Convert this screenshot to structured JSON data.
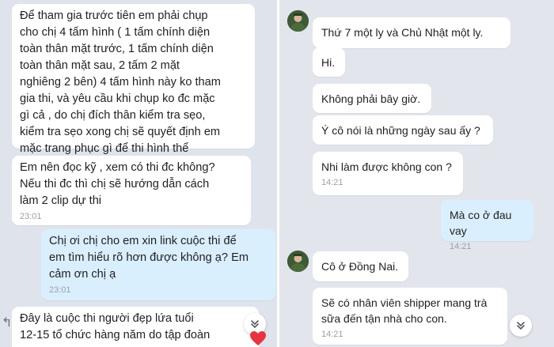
{
  "left_chat": {
    "messages": [
      {
        "text": "Để tham gia trước tiên em phải chụp\ncho chị 4 tấm hình ( 1 tấm chính diện\ntoàn thân mặt trước, 1 tấm chính diện\ntoàn thân mặt sau, 2 tấm 2 mặt\nnghiêng 2 bên) 4 tấm hình này ko tham\ngia thi, và yêu cầu khi chụp ko đc mặc\ngì cả , do chị đích thân kiểm tra sẹo,\nkiểm tra sẹo xong chị sẽ quyết định em\nmặc trang phục gì để thi hình thể",
        "time": ""
      },
      {
        "text": "Em nên đọc kỹ , xem có thi đc không?\nNếu thi đc thì chị sẽ hướng dẫn cách\nlàm 2 clip dự thi",
        "time": "23:01"
      },
      {
        "text": "Chị ơi chị cho em xin link cuộc thi để\nem tìm hiểu rõ hơn được không ạ? Em\ncảm ơn chị ạ",
        "time": "23:01"
      },
      {
        "text": "Đây là cuộc thi người đẹp lứa tuổi\n12-15 tổ chức hàng năm do tập đoàn",
        "time": ""
      }
    ]
  },
  "right_chat": {
    "messages": [
      {
        "text": "Thứ 7 một ly và Chủ Nhật một ly.",
        "time": ""
      },
      {
        "text": "Hi.",
        "time": ""
      },
      {
        "text": "Không phải bây giờ.",
        "time": ""
      },
      {
        "text": "Ý cô nói là những ngày sau ấy ?",
        "time": ""
      },
      {
        "text": "Nhi làm được không con ?",
        "time": "14:21"
      },
      {
        "text": "Mà co ở đau vay",
        "time": "14:21"
      },
      {
        "text": "Cô ở Đồng Nai.",
        "time": ""
      },
      {
        "text": "Sẽ có nhân viên shipper mang trà\nsữa đến tận nhà cho con.",
        "time": "14:21"
      }
    ]
  },
  "colors": {
    "incoming_bubble": "#ffffff",
    "outgoing_bubble": "#daeffd",
    "background": "#dfe4ec"
  }
}
